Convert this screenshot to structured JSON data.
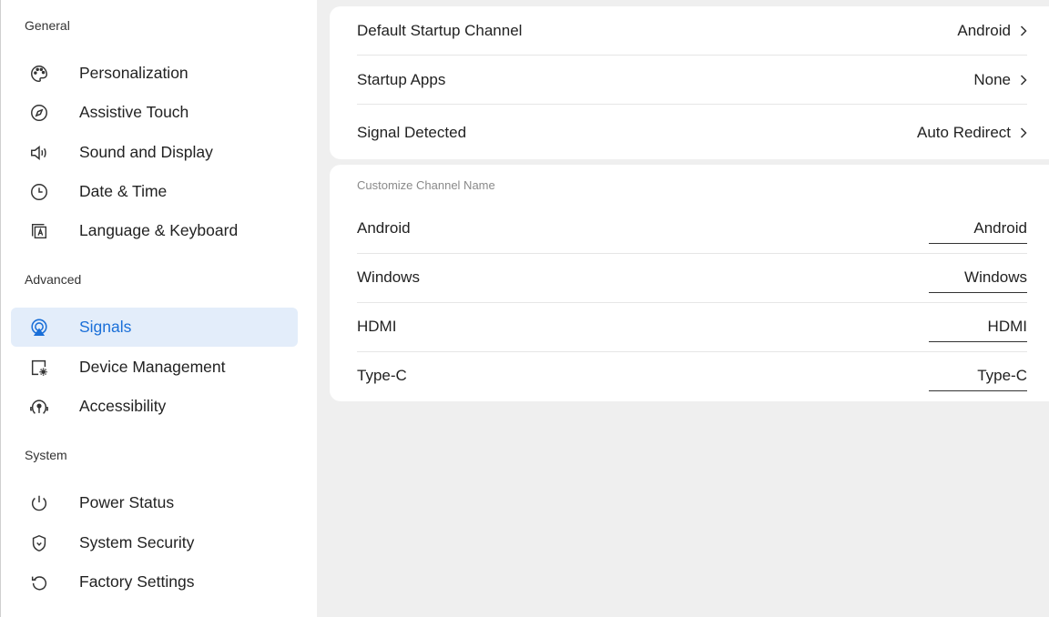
{
  "sidebar": {
    "sections": {
      "general": "General",
      "advanced": "Advanced",
      "system": "System"
    },
    "items": [
      {
        "label": "Personalization",
        "icon": "palette-icon"
      },
      {
        "label": "Assistive Touch",
        "icon": "compass-icon"
      },
      {
        "label": "Sound and Display",
        "icon": "speaker-icon"
      },
      {
        "label": "Date & Time",
        "icon": "clock-icon"
      },
      {
        "label": "Language & Keyboard",
        "icon": "keyboard-language-icon"
      },
      {
        "label": "Signals",
        "icon": "signal-icon",
        "active": true
      },
      {
        "label": "Device Management",
        "icon": "device-settings-icon"
      },
      {
        "label": "Accessibility",
        "icon": "accessibility-icon"
      },
      {
        "label": "Power Status",
        "icon": "power-icon"
      },
      {
        "label": "System Security",
        "icon": "shield-icon"
      },
      {
        "label": "Factory Settings",
        "icon": "reset-icon"
      }
    ]
  },
  "startup": {
    "default_channel": {
      "label": "Default Startup Channel",
      "value": "Android"
    },
    "startup_apps": {
      "label": "Startup Apps",
      "value": "None"
    },
    "signal_detected": {
      "label": "Signal Detected",
      "value": "Auto Redirect"
    }
  },
  "channel_names": {
    "header": "Customize Channel Name",
    "rows": [
      {
        "label": "Android",
        "value": "Android"
      },
      {
        "label": "Windows",
        "value": "Windows"
      },
      {
        "label": "HDMI",
        "value": "HDMI"
      },
      {
        "label": "Type-C",
        "value": "Type-C"
      }
    ]
  },
  "colors": {
    "accent": "#1a6fd8",
    "active_bg": "#e3edfa",
    "panel_bg": "#efefef"
  }
}
